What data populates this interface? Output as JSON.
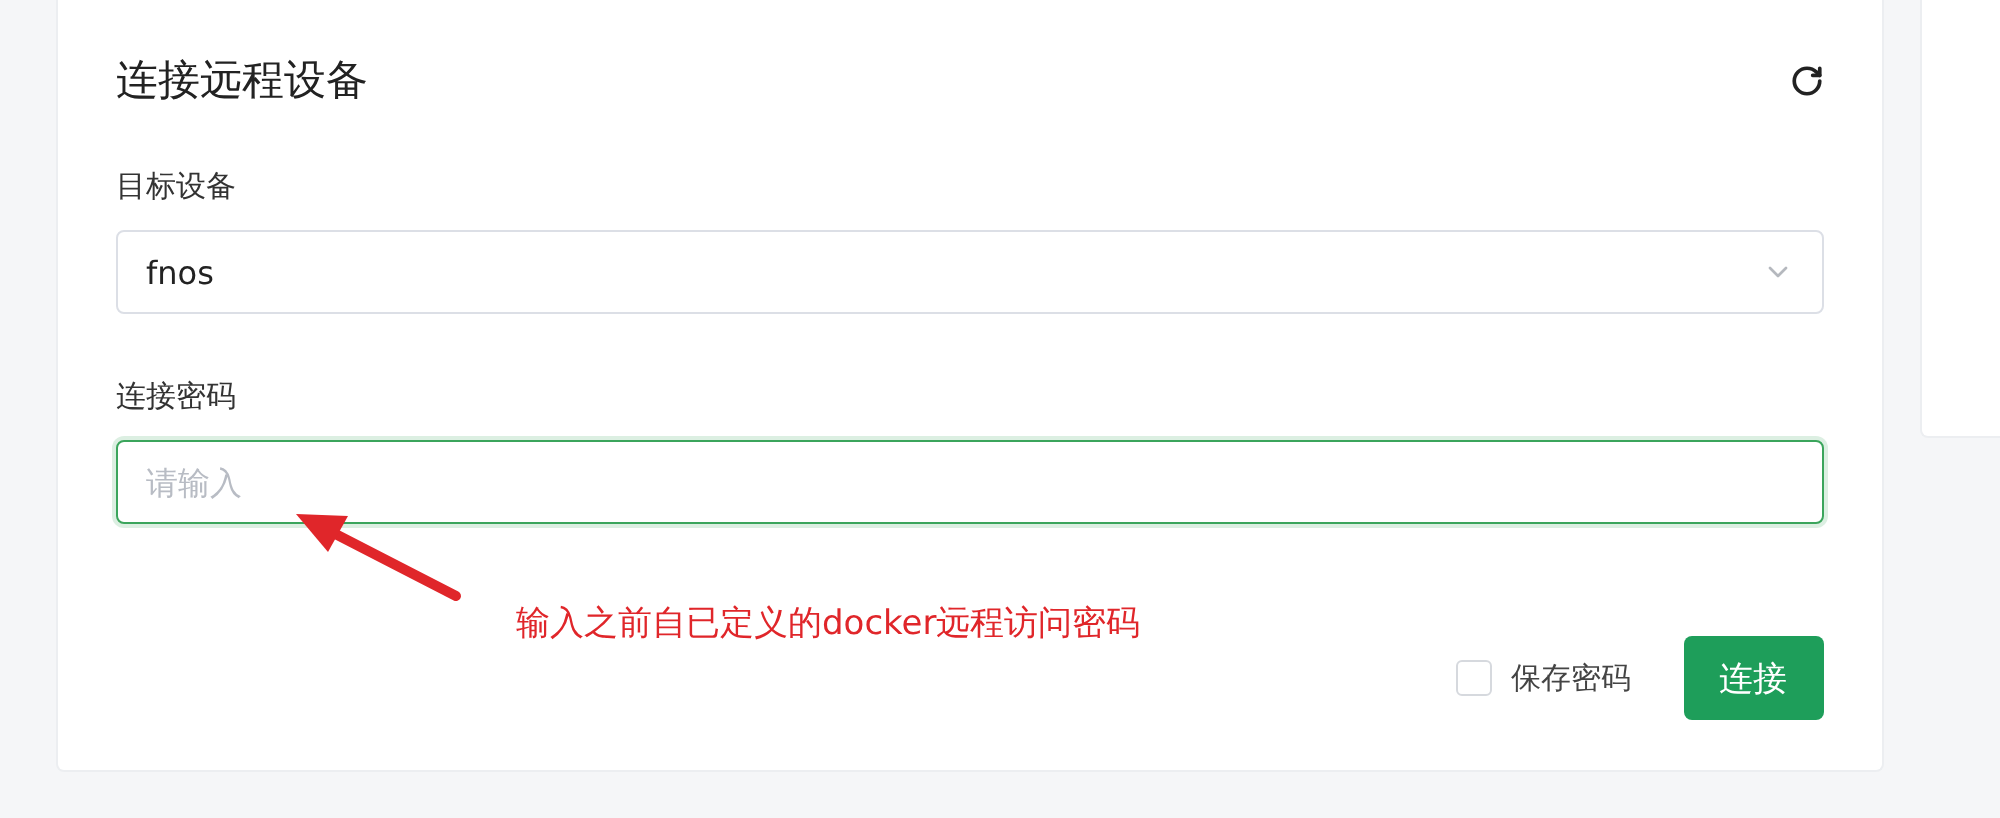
{
  "card": {
    "title": "连接远程设备"
  },
  "target_device": {
    "label": "目标设备",
    "value": "fnos"
  },
  "password": {
    "label": "连接密码",
    "placeholder": "请输入",
    "focused": true
  },
  "save_password": {
    "label": "保存密码",
    "checked": false
  },
  "connect_button": {
    "label": "连接"
  },
  "annotation": {
    "text": "输入之前自已定义的docker远程访问密码"
  }
}
